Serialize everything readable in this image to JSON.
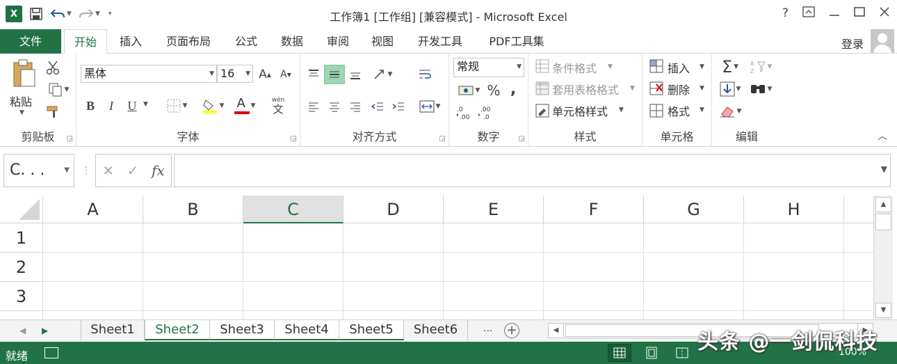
{
  "titlebar": {
    "title": "工作簿1  [工作组]  [兼容模式] - Microsoft Excel",
    "app_logo": "X",
    "help": "?",
    "icons": [
      "save-icon",
      "undo-icon",
      "redo-icon",
      "customize-qat-icon",
      "ribbon-display-icon",
      "minimize-icon",
      "maximize-icon",
      "close-icon"
    ]
  },
  "tabs": [
    {
      "label": "文件"
    },
    {
      "label": "开始"
    },
    {
      "label": "插入"
    },
    {
      "label": "页面布局"
    },
    {
      "label": "公式"
    },
    {
      "label": "数据"
    },
    {
      "label": "审阅"
    },
    {
      "label": "视图"
    },
    {
      "label": "开发工具"
    },
    {
      "label": "PDF工具集"
    }
  ],
  "account": {
    "login": "登录"
  },
  "ribbon": {
    "clipboard": {
      "label": "剪贴板",
      "paste": "粘贴"
    },
    "font": {
      "label": "字体",
      "font_name": "黑体",
      "font_size": "16",
      "bold": "B",
      "italic": "I",
      "underline": "U",
      "font_color_letter": "A",
      "wen": "wén",
      "wen_char": "文"
    },
    "alignment": {
      "label": "对齐方式"
    },
    "number": {
      "label": "数字",
      "format": "常规",
      "percent": "%",
      "comma": ","
    },
    "styles": {
      "label": "样式",
      "conditional": "条件格式",
      "table": "套用表格格式",
      "cell_styles": "单元格样式"
    },
    "cells": {
      "label": "单元格",
      "insert": "插入",
      "delete": "删除",
      "format": "格式"
    },
    "editing": {
      "label": "编辑",
      "sigma": "Σ"
    }
  },
  "formula_bar": {
    "name_box": "C. . .",
    "fx": "fx",
    "value": ""
  },
  "grid": {
    "columns": [
      "A",
      "B",
      "C",
      "D",
      "E",
      "F",
      "G",
      "H"
    ],
    "rows": [
      "1",
      "2",
      "3"
    ],
    "selected_column": "C"
  },
  "sheets": {
    "tabs": [
      "Sheet1",
      "Sheet2",
      "Sheet3",
      "Sheet4",
      "Sheet5",
      "Sheet6"
    ],
    "active": "Sheet2",
    "more": "...",
    "add": "+"
  },
  "status": {
    "text": "就绪",
    "zoom": "100%"
  },
  "watermark": "头条 @一剑侃科技",
  "colors": {
    "accent": "#217346"
  }
}
